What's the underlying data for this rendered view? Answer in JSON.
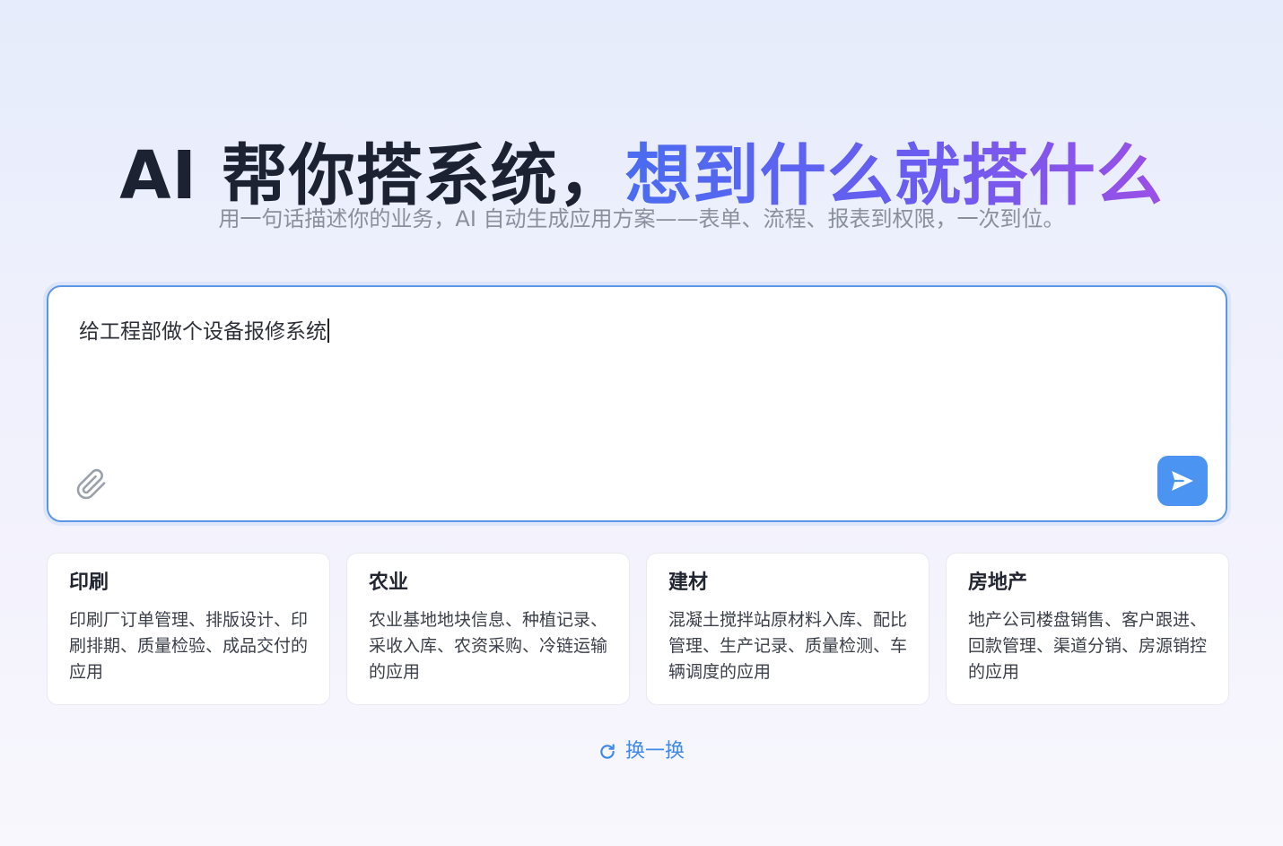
{
  "hero": {
    "title_dark": "AI 帮你搭系统，",
    "title_highlight": "想到什么就搭什么",
    "subtitle": "用一句话描述你的业务，AI 自动生成应用方案——表单、流程、报表到权限，一次到位。"
  },
  "prompt": {
    "value": "给工程部做个设备报修系统",
    "attach_icon": "paperclip-icon",
    "send_icon": "send-icon"
  },
  "cards": [
    {
      "title": "印刷",
      "desc": "印刷厂订单管理、排版设计、印刷排期、质量检验、成品交付的应用"
    },
    {
      "title": "农业",
      "desc": "农业基地地块信息、种植记录、采收入库、农资采购、冷链运输的应用"
    },
    {
      "title": "建材",
      "desc": "混凝土搅拌站原材料入库、配比管理、生产记录、质量检测、车辆调度的应用"
    },
    {
      "title": "房地产",
      "desc": "地产公司楼盘销售、客户跟进、回款管理、渠道分销、房源销控的应用"
    }
  ],
  "refresh": {
    "label": "换一换",
    "icon": "refresh-icon"
  },
  "colors": {
    "accent": "#4b94f2",
    "border": "#5b97e6",
    "gradient_start": "#4a6cf0",
    "gradient_end": "#9b4fe6"
  }
}
